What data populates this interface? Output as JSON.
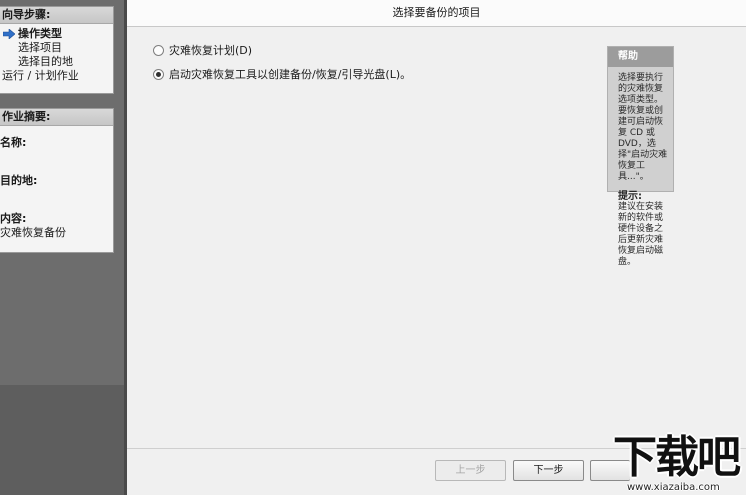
{
  "window": {
    "title": "选择要备份的项目"
  },
  "wizard_steps": {
    "header": "向导步骤:",
    "items": [
      {
        "label": "操作类型",
        "current": true
      },
      {
        "label": "选择项目",
        "current": false
      },
      {
        "label": "选择目的地",
        "current": false
      },
      {
        "label": "运行 / 计划作业",
        "current": false
      }
    ]
  },
  "job_summary": {
    "header": "作业摘要:",
    "name_label": "名称:",
    "destination_label": "目的地:",
    "contents_label": "内容:",
    "contents_value": "灾难恢复备份"
  },
  "options": [
    {
      "label": "灾难恢复计划(D)",
      "selected": false
    },
    {
      "label": "启动灾难恢复工具以创建备份/恢复/引导光盘(L)。",
      "selected": true
    }
  ],
  "help": {
    "header": "帮助",
    "text": "选择要执行的灾难恢复选项类型。要恢复或创建可启动恢复 CD 或 DVD，选择\"启动灾难恢复工具...\"。",
    "tip_header": "提示:",
    "tip_text": "建议在安装新的软件或硬件设备之后更新灾难恢复启动磁盘。"
  },
  "buttons": {
    "back": "上一步",
    "next": "下一步"
  },
  "watermark": {
    "text": "下载吧",
    "url": "www.xiazaiba.com"
  },
  "colors": {
    "left_pane": "#6d6d6d",
    "main_bg": "#f0f0f0",
    "help_header": "#9c9c9c",
    "help_bg": "#d0d0d0"
  }
}
